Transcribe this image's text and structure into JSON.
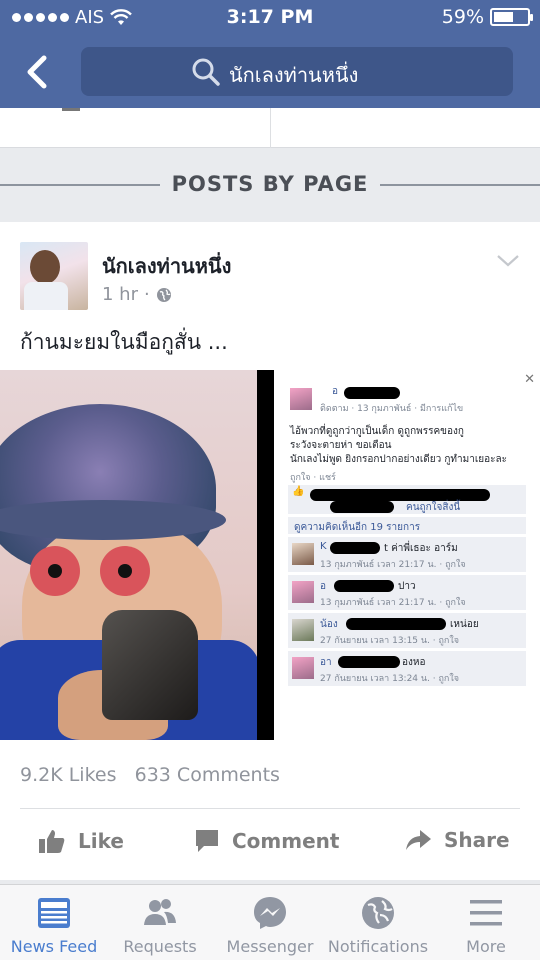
{
  "status_bar": {
    "carrier": "AIS",
    "time": "3:17 PM",
    "battery": "59%",
    "battery_fraction": 0.59
  },
  "search": {
    "query": "นักเลงท่านหนึ่ง"
  },
  "section": {
    "title": "POSTS BY PAGE"
  },
  "post": {
    "page_name": "นักเลงท่านหนึ่ง",
    "time": "1 hr",
    "text": "ก้านมะยมในมือกูสั่น ...",
    "likes": "9.2K Likes",
    "comments": "633 Comments",
    "actions": {
      "like": "Like",
      "comment": "Comment",
      "share": "Share"
    },
    "screenshot": {
      "header_meta": "ติดตาม · 13 กุมภาพันธ์ · มีการแก้ไข",
      "body_line1": "ไอ้พวกที่ดูถูกว่ากูเป็นเด็ก ดูถูกพรรคของกู",
      "body_line2": "ระวังจะตายห่า ขอเตือน",
      "body_line3": "นักเลงไม่พูด ยิงกรอกปากอย่างเดียว กูทำมาเยอะละ",
      "actions_small": "ถูกใจ · แชร์",
      "like_line_suffix": "คนถูกใจสิ่งนี้",
      "more_comments": "ดูความคิดเห็นอีก 19 รายการ",
      "comments": [
        {
          "prefix": "K",
          "text": "t ค่าพี่เธอะ อาร์ม",
          "meta": "13 กุมภาพันธ์ เวลา 21:17 น. · ถูกใจ"
        },
        {
          "prefix": "อ",
          "text": "ปาว",
          "meta": "13 กุมภาพันธ์ เวลา 21:17 น. · ถูกใจ"
        },
        {
          "prefix": "น้อง",
          "text": "เหน่อย",
          "meta": "27 กันยายน เวลา 13:15 น. · ถูกใจ"
        },
        {
          "prefix": "อา",
          "text": "องหอ",
          "meta": "27 กันยายน เวลา 13:24 น. · ถูกใจ"
        }
      ]
    }
  },
  "tabs": [
    {
      "label": "News Feed",
      "icon": "news-feed-icon",
      "active": true
    },
    {
      "label": "Requests",
      "icon": "friend-requests-icon",
      "active": false
    },
    {
      "label": "Messenger",
      "icon": "messenger-icon",
      "active": false
    },
    {
      "label": "Notifications",
      "icon": "globe-icon",
      "active": false
    },
    {
      "label": "More",
      "icon": "menu-icon",
      "active": false
    }
  ],
  "colors": {
    "header": "#4e69a2",
    "search_bg": "#3e5689",
    "active_tab": "#4a7dce",
    "inactive_tab": "#9197a3"
  }
}
